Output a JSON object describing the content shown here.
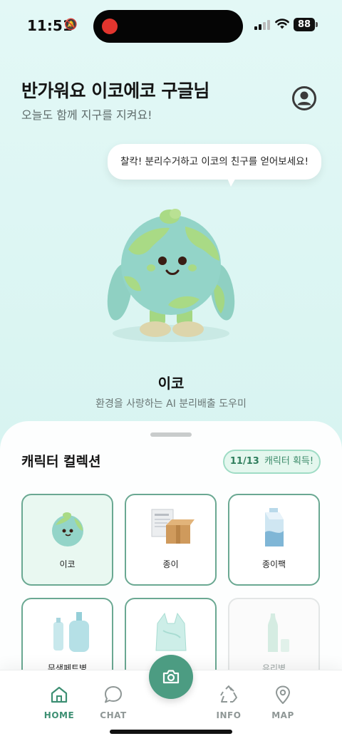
{
  "status_bar": {
    "time": "11:51",
    "battery": "88"
  },
  "header": {
    "greeting": "반가워요 이코에코 구글님",
    "subtitle": "오늘도 함께 지구를 지켜요!"
  },
  "bubble": {
    "text": "찰칵! 분리수거하고 이코의 친구를 얻어보세요!"
  },
  "mascot": {
    "name": "이코",
    "description": "환경을 사랑하는 AI 분리배출 도우미"
  },
  "collection": {
    "title": "캐릭터 컬렉션",
    "count": "11/13",
    "count_suffix": "캐릭터 획득!",
    "cards": [
      {
        "label": "이코",
        "icon": "earth-character-icon"
      },
      {
        "label": "종이",
        "icon": "paper-box-icon"
      },
      {
        "label": "종이팩",
        "icon": "milk-carton-icon"
      },
      {
        "label": "무색페트병",
        "icon": "pet-bottle-icon"
      },
      {
        "label": "",
        "icon": "plastic-bag-icon"
      },
      {
        "label": "유리병",
        "icon": "glass-bottle-icon"
      }
    ]
  },
  "nav": {
    "items": [
      {
        "label": "HOME",
        "icon": "home-icon"
      },
      {
        "label": "CHAT",
        "icon": "chat-icon"
      },
      {
        "label": "INFO",
        "icon": "recycle-icon"
      },
      {
        "label": "MAP",
        "icon": "map-pin-icon"
      }
    ],
    "camera_icon": "camera-icon"
  },
  "colors": {
    "accent": "#4c9c82",
    "background": "#dcf6f3",
    "card_border": "#6aa892",
    "badge_bg": "#e4f7ee"
  }
}
